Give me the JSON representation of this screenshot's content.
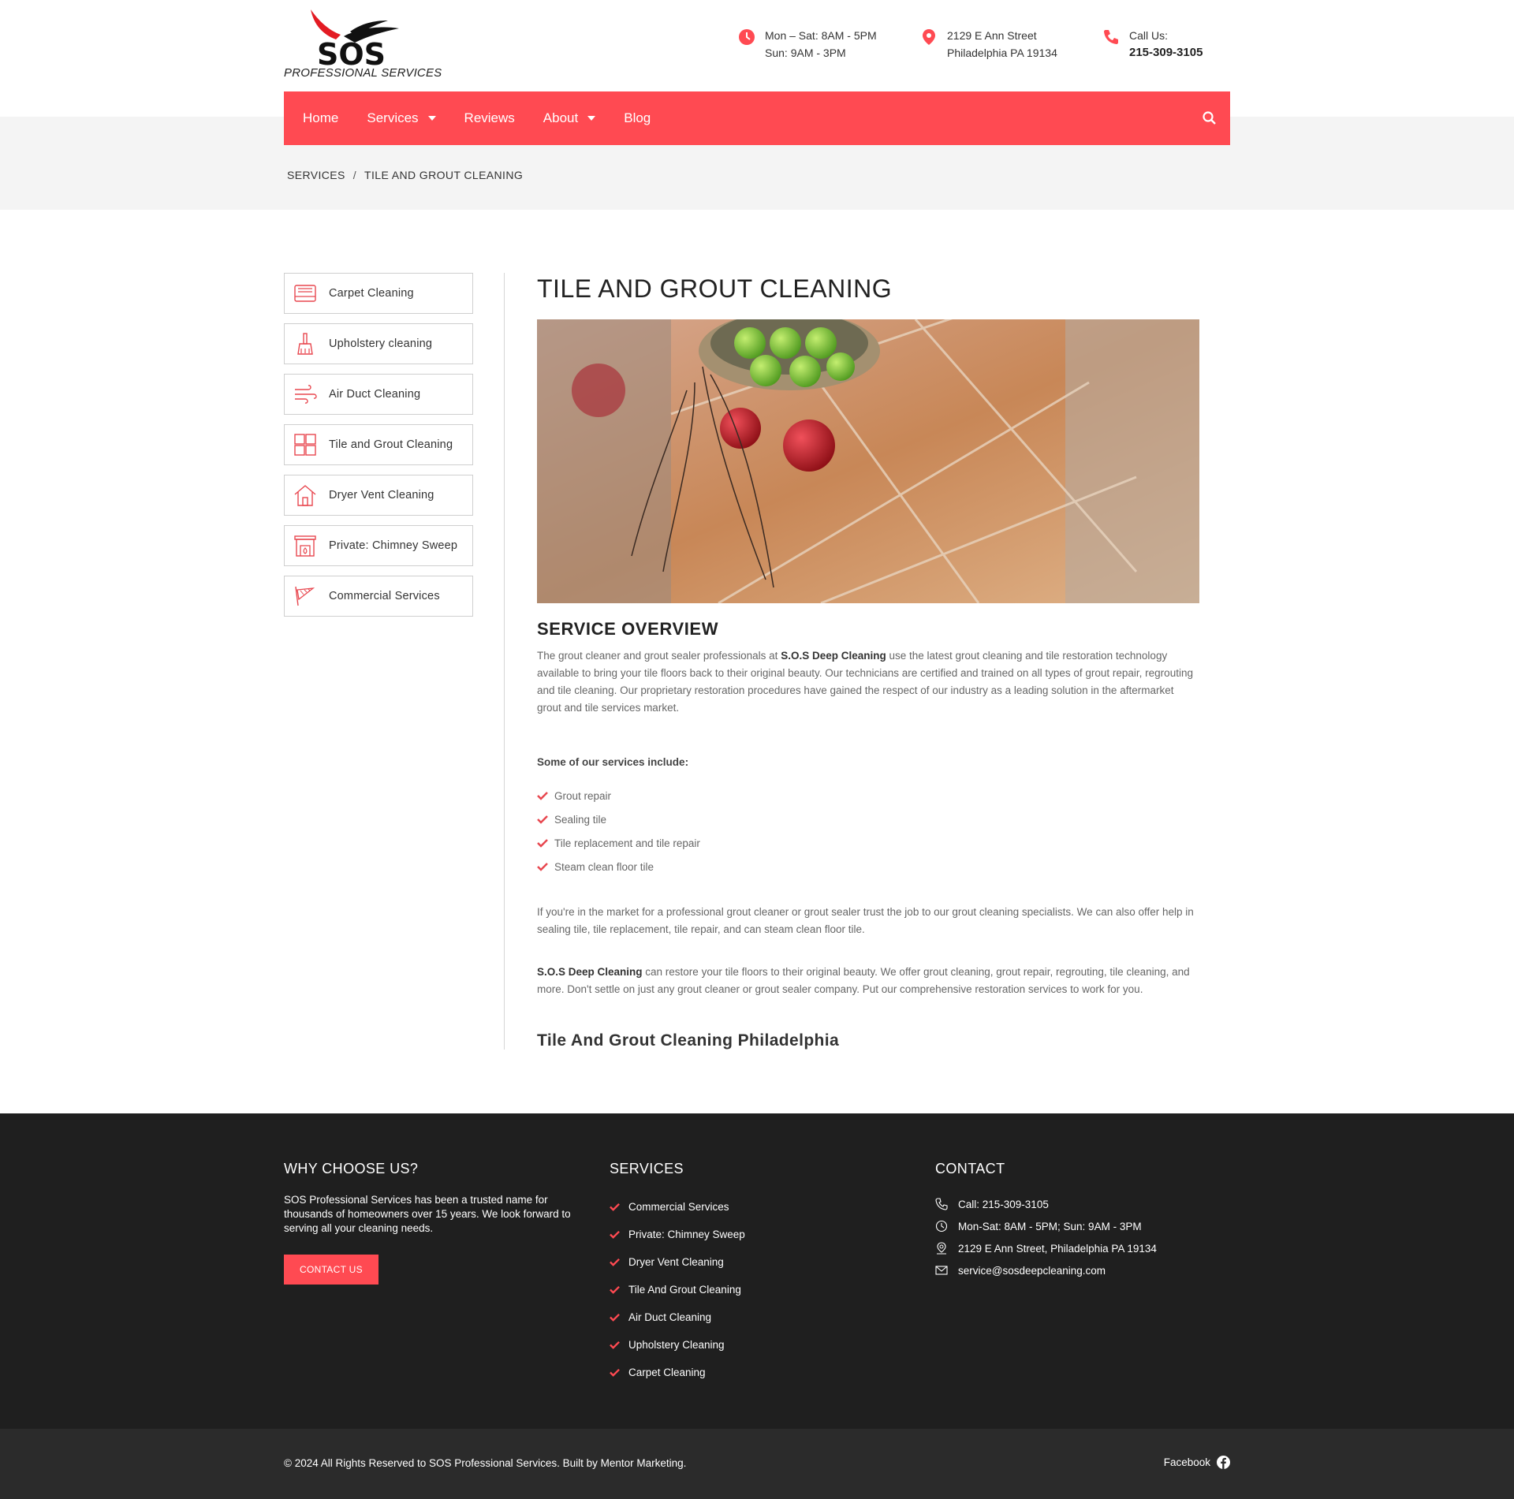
{
  "brand": {
    "logo_text": "SOS",
    "logo_tagline": "PROFESSIONAL SERVICES",
    "accent": "#ff4a52"
  },
  "header": {
    "hours_line1": "Mon – Sat: 8AM - 5PM",
    "hours_line2": "Sun: 9AM - 3PM",
    "address_line1": "2129 E Ann Street",
    "address_line2": "Philadelphia PA 19134",
    "call_label": "Call Us:",
    "call_number": "215-309-3105"
  },
  "nav": {
    "items": [
      {
        "label": "Home",
        "dropdown": false
      },
      {
        "label": "Services",
        "dropdown": true
      },
      {
        "label": "Reviews",
        "dropdown": false
      },
      {
        "label": "About",
        "dropdown": true
      },
      {
        "label": "Blog",
        "dropdown": false
      }
    ],
    "search_icon": "search-icon"
  },
  "breadcrumb": {
    "parent": "SERVICES",
    "separator": "/",
    "current": "TILE AND GROUT CLEANING"
  },
  "sidebar": {
    "items": [
      {
        "label": "Carpet Cleaning",
        "icon": "carpet-icon"
      },
      {
        "label": "Upholstery cleaning",
        "icon": "brush-icon"
      },
      {
        "label": "Air Duct Cleaning",
        "icon": "wind-icon"
      },
      {
        "label": "Tile and Grout Cleaning",
        "icon": "tiles-icon"
      },
      {
        "label": "Dryer Vent Cleaning",
        "icon": "house-icon"
      },
      {
        "label": "Private: Chimney Sweep",
        "icon": "fireplace-icon"
      },
      {
        "label": "Commercial Services",
        "icon": "duster-icon"
      }
    ]
  },
  "main": {
    "title": "TILE AND GROUT CLEANING",
    "overview_heading": "SERVICE OVERVIEW",
    "overview_pre": "The grout cleaner and grout sealer professionals at ",
    "overview_bold": "S.O.S Deep Cleaning",
    "overview_post": " use the latest grout cleaning and tile restoration technology available to bring your tile floors back to their original beauty. Our technicians are certified and trained on all types of grout repair, regrouting and tile cleaning. Our proprietary restoration procedures have gained the respect of our industry as a leading solution in the aftermarket grout and tile services market.",
    "services_intro": "Some of our services include:",
    "services_list": [
      "Grout repair",
      "Sealing tile",
      "Tile replacement and tile repair",
      "Steam clean floor tile"
    ],
    "para2": "If you're in the market for a professional grout cleaner or grout sealer trust the job to our grout cleaning specialists. We can also offer help in sealing tile, tile replacement, tile repair, and can steam clean floor tile.",
    "para3_bold": "S.O.S Deep Cleaning",
    "para3_rest": " can restore your tile floors to their original beauty. We offer grout cleaning, grout repair, regrouting, tile cleaning, and more. Don't settle on just any grout cleaner or grout sealer company. Put our comprehensive restoration services to work for you.",
    "subheading": "Tile And Grout Cleaning Philadelphia"
  },
  "footer": {
    "why_heading": "WHY CHOOSE US?",
    "why_text": "SOS Professional Services has been a trusted name for thousands of homeowners over 15 years. We look forward to serving all your cleaning needs.",
    "cta_label": "CONTACT US",
    "services_heading": "SERVICES",
    "services": [
      "Commercial Services",
      "Private: Chimney Sweep",
      "Dryer Vent Cleaning",
      "Tile And Grout Cleaning",
      "Air Duct Cleaning",
      "Upholstery Cleaning",
      "Carpet Cleaning"
    ],
    "contact_heading": "CONTACT",
    "contact": [
      {
        "text": "Call: 215-309-3105",
        "icon": "phone-icon"
      },
      {
        "text": "Mon-Sat: 8AM - 5PM; Sun: 9AM - 3PM",
        "icon": "clock-icon"
      },
      {
        "text": "2129 E Ann Street, Philadelphia PA 19134",
        "icon": "location-icon"
      },
      {
        "text": "service@sosdeepcleaning.com",
        "icon": "mail-icon"
      }
    ],
    "copyright": "© 2024 All Rights Reserved to SOS Professional Services. Built by Mentor Marketing.",
    "facebook_label": "Facebook"
  }
}
